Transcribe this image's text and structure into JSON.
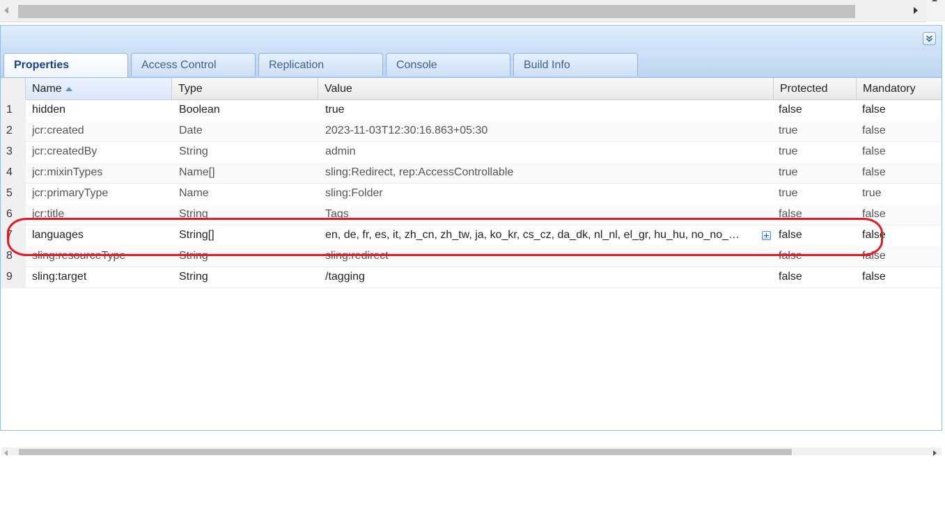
{
  "tabs": [
    {
      "label": "Properties",
      "active": true
    },
    {
      "label": "Access Control",
      "active": false
    },
    {
      "label": "Replication",
      "active": false
    },
    {
      "label": "Console",
      "active": false
    },
    {
      "label": "Build Info",
      "active": false
    }
  ],
  "columns": {
    "name": "Name",
    "type": "Type",
    "value": "Value",
    "protected": "Protected",
    "mandatory": "Mandatory"
  },
  "rows": [
    {
      "num": "1",
      "name": "hidden",
      "type": "Boolean",
      "value": "true",
      "protected": "false",
      "mandatory": "false"
    },
    {
      "num": "2",
      "name": "jcr:created",
      "type": "Date",
      "value": "2023-11-03T12:30:16.863+05:30",
      "protected": "true",
      "mandatory": "false"
    },
    {
      "num": "3",
      "name": "jcr:createdBy",
      "type": "String",
      "value": "admin",
      "protected": "true",
      "mandatory": "false"
    },
    {
      "num": "4",
      "name": "jcr:mixinTypes",
      "type": "Name[]",
      "value": "sling:Redirect, rep:AccessControllable",
      "protected": "true",
      "mandatory": "false"
    },
    {
      "num": "5",
      "name": "jcr:primaryType",
      "type": "Name",
      "value": "sling:Folder",
      "protected": "true",
      "mandatory": "true"
    },
    {
      "num": "6",
      "name": "jcr:title",
      "type": "String",
      "value": "Tags",
      "protected": "false",
      "mandatory": "false"
    },
    {
      "num": "7",
      "name": "languages",
      "type": "String[]",
      "value": "en, de, fr, es, it, zh_cn, zh_tw, ja, ko_kr, cs_cz, da_dk, nl_nl, el_gr, hu_hu, no_no_…",
      "protected": "false",
      "mandatory": "false"
    },
    {
      "num": "8",
      "name": "sling:resourceType",
      "type": "String",
      "value": "sling:redirect",
      "protected": "false",
      "mandatory": "false"
    },
    {
      "num": "9",
      "name": "sling:target",
      "type": "String",
      "value": "/tagging",
      "protected": "false",
      "mandatory": "false"
    }
  ],
  "icons": {
    "collapse": "double-chevron-down-icon",
    "sort": "sort-ascending-icon",
    "expand": "plus-box-icon"
  },
  "colors": {
    "accent": "#15428b",
    "panel_border": "#99bbe8",
    "highlight": "#e01b24"
  }
}
